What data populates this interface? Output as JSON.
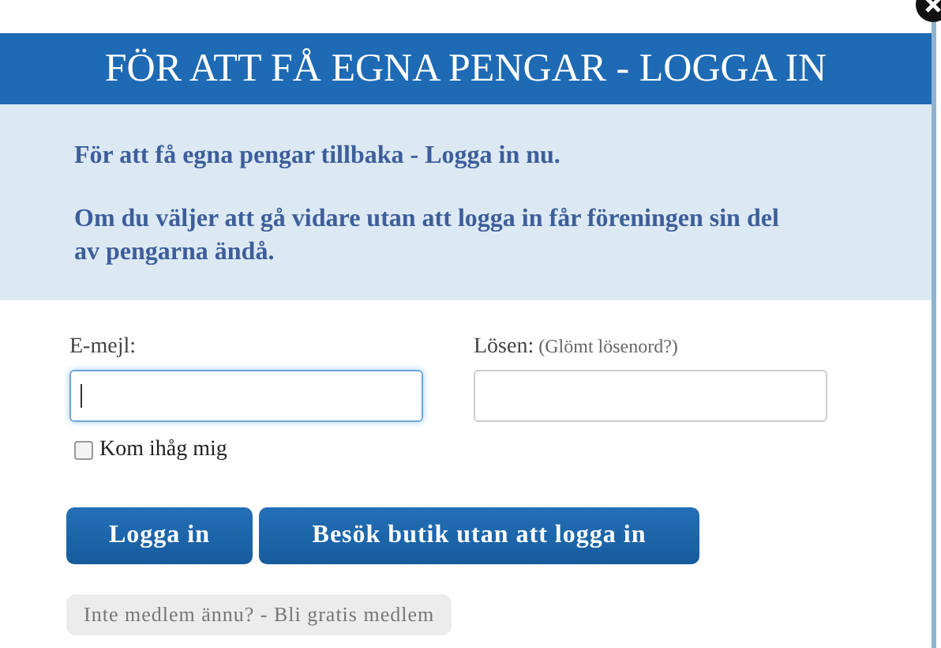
{
  "dialog": {
    "title": "FÖR ATT FÅ EGNA PENGAR - LOGGA IN"
  },
  "intro": [
    "För att få egna pengar tillbaka - Logga in nu.",
    "Om du väljer att gå vidare utan att logga in får föreningen sin del av pengarna ändå."
  ],
  "fields": [
    {
      "label": "E-mejl:",
      "focused": true
    },
    {
      "label": "Lösen:",
      "hint_link": "(Glömt lösenord?)",
      "focused": false
    }
  ],
  "remember": {
    "label": "Kom ihåg mig",
    "checked": false
  },
  "buttons": [
    "Logga in",
    "Besök butik utan att logga in"
  ],
  "signup_link": "Inte medlem ännu? - Bli gratis medlem"
}
